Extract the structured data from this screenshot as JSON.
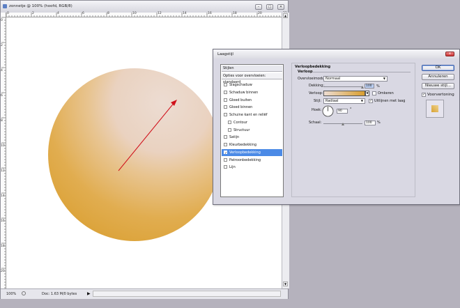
{
  "document": {
    "title": "zonnetje @ 100% (hoofd, RGB/8)",
    "window_buttons": [
      "–",
      "□",
      "✕"
    ],
    "ruler_top_labels": [
      "0",
      "2",
      "4",
      "6",
      "8",
      "10",
      "12",
      "14",
      "16",
      "18",
      "20",
      "22"
    ],
    "ruler_left_labels": [
      "0",
      "2",
      "4",
      "6",
      "8",
      "10",
      "12",
      "14",
      "16",
      "18",
      "20",
      "22"
    ],
    "zoom": "100%",
    "doc_size": "Doc: 1.63 M/0 bytes",
    "colors": {
      "sphere_light": "#ecdcd2",
      "sphere_mid": "#e6b86a",
      "sphere_dark": "#d9a030",
      "arrow": "#d0101a"
    }
  },
  "dialog": {
    "title": "Laagstijl",
    "close_label": "x",
    "styles_header": "Stijlen",
    "blend_options": "Opties voor overvloeien: standaard",
    "items": [
      {
        "label": "Slagschaduw",
        "checked": false,
        "sub": false,
        "selected": false
      },
      {
        "label": "Schaduw binnen",
        "checked": false,
        "sub": false,
        "selected": false
      },
      {
        "label": "Gloed buiten",
        "checked": false,
        "sub": false,
        "selected": false
      },
      {
        "label": "Gloed binnen",
        "checked": false,
        "sub": false,
        "selected": false
      },
      {
        "label": "Schuine kant en reliëf",
        "checked": false,
        "sub": false,
        "selected": false
      },
      {
        "label": "Contour",
        "checked": false,
        "sub": true,
        "selected": false
      },
      {
        "label": "Structuur",
        "checked": false,
        "sub": true,
        "selected": false
      },
      {
        "label": "Satijn",
        "checked": false,
        "sub": false,
        "selected": false
      },
      {
        "label": "Kleurbedekking",
        "checked": false,
        "sub": false,
        "selected": false
      },
      {
        "label": "Verloopbedekking",
        "checked": true,
        "sub": false,
        "selected": true
      },
      {
        "label": "Patroonbedekking",
        "checked": false,
        "sub": false,
        "selected": false
      },
      {
        "label": "Lijn",
        "checked": false,
        "sub": false,
        "selected": false
      }
    ],
    "section_title": "Verloopbedekking",
    "group_title": "Verloop",
    "blend_mode_label": "Overvloeimodus:",
    "blend_mode_value": "Normaal",
    "opacity_label": "Dekking:",
    "opacity_value": "100",
    "opacity_unit": "%",
    "gradient_label": "Verloop:",
    "reverse_label": "Omkeren",
    "reverse_checked": false,
    "style_label": "Stijl:",
    "style_value": "Radiaal",
    "align_label": "Uitlijnen met laag",
    "align_checked": true,
    "angle_label": "Hoek:",
    "angle_value": "90",
    "angle_unit": "°",
    "scale_label": "Schaal:",
    "scale_value": "100",
    "scale_unit": "%",
    "scale_level": 1.0,
    "opacity_level": 1.0,
    "ok_label": "OK",
    "cancel_label": "Annuleren",
    "new_style_label": "Nieuwe stijl...",
    "preview_label": "Voorvertoning",
    "preview_checked": true,
    "accent_color": "#4b8ae6"
  }
}
